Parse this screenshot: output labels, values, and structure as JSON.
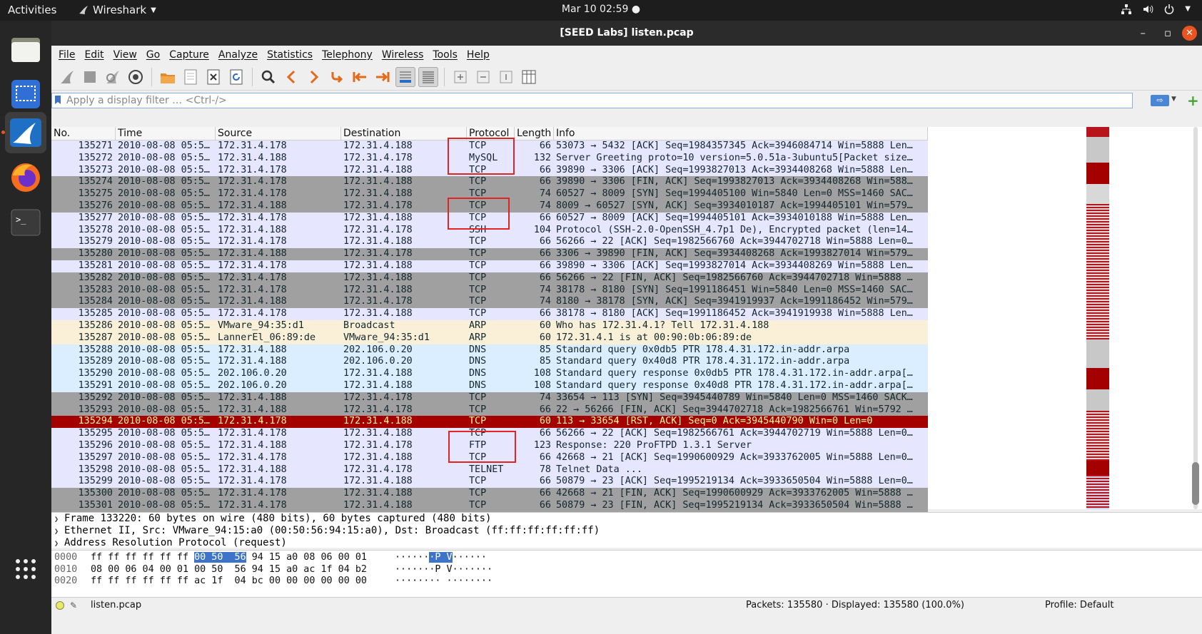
{
  "topbar": {
    "activities": "Activities",
    "app_name": "Wireshark",
    "clock": "Mar 10  02:59",
    "tray_icons": [
      "network-icon",
      "volume-icon",
      "power-icon"
    ]
  },
  "dock": {
    "items": [
      "files-icon",
      "screenshot-icon",
      "wireshark-icon",
      "firefox-icon",
      "terminal-icon"
    ],
    "grid": "show-apps-icon"
  },
  "window": {
    "title": "[SEED Labs] listen.pcap",
    "minimize": "–",
    "maximize": "▫",
    "close": "✕"
  },
  "menu": [
    "File",
    "Edit",
    "View",
    "Go",
    "Capture",
    "Analyze",
    "Statistics",
    "Telephony",
    "Wireless",
    "Tools",
    "Help"
  ],
  "filter": {
    "placeholder": "Apply a display filter … <Ctrl-/>",
    "apply": "⇨"
  },
  "columns": [
    "No.",
    "Time",
    "Source",
    "Destination",
    "Protocol",
    "Length",
    "Info"
  ],
  "packets": [
    {
      "no": "135271",
      "time": "2010-08-08 05:5…",
      "src": "172.31.4.178",
      "dst": "172.31.4.188",
      "proto": "TCP",
      "len": "66",
      "info": "53073 → 5432 [ACK] Seq=1984357345 Ack=3946084714 Win=5888 Len…",
      "style": "t-tcp"
    },
    {
      "no": "135272",
      "time": "2010-08-08 05:5…",
      "src": "172.31.4.188",
      "dst": "172.31.4.178",
      "proto": "MySQL",
      "len": "132",
      "info": "Server Greeting proto=10 version=5.0.51a-3ubuntu5[Packet size…",
      "style": "t-tcp"
    },
    {
      "no": "135273",
      "time": "2010-08-08 05:5…",
      "src": "172.31.4.178",
      "dst": "172.31.4.188",
      "proto": "TCP",
      "len": "66",
      "info": "39890 → 3306 [ACK] Seq=1993827013 Ack=3934408268 Win=5888 Len…",
      "style": "t-tcp"
    },
    {
      "no": "135274",
      "time": "2010-08-08 05:5…",
      "src": "172.31.4.178",
      "dst": "172.31.4.188",
      "proto": "TCP",
      "len": "66",
      "info": "39890 → 3306 [FIN, ACK] Seq=1993827013 Ack=3934408268 Win=588…",
      "style": "t-tcpx"
    },
    {
      "no": "135275",
      "time": "2010-08-08 05:5…",
      "src": "172.31.4.178",
      "dst": "172.31.4.188",
      "proto": "TCP",
      "len": "74",
      "info": "60527 → 8009 [SYN] Seq=1994405100 Win=5840 Len=0 MSS=1460 SAC…",
      "style": "t-tcpx"
    },
    {
      "no": "135276",
      "time": "2010-08-08 05:5…",
      "src": "172.31.4.188",
      "dst": "172.31.4.178",
      "proto": "TCP",
      "len": "74",
      "info": "8009 → 60527 [SYN, ACK] Seq=3934010187 Ack=1994405101 Win=579…",
      "style": "t-tcpx"
    },
    {
      "no": "135277",
      "time": "2010-08-08 05:5…",
      "src": "172.31.4.178",
      "dst": "172.31.4.188",
      "proto": "TCP",
      "len": "66",
      "info": "60527 → 8009 [ACK] Seq=1994405101 Ack=3934010188 Win=5888 Len…",
      "style": "t-tcp"
    },
    {
      "no": "135278",
      "time": "2010-08-08 05:5…",
      "src": "172.31.4.188",
      "dst": "172.31.4.178",
      "proto": "SSH",
      "len": "104",
      "info": "Protocol (SSH-2.0-OpenSSH_4.7p1 De), Encrypted packet (len=14…",
      "style": "t-tcp"
    },
    {
      "no": "135279",
      "time": "2010-08-08 05:5…",
      "src": "172.31.4.178",
      "dst": "172.31.4.188",
      "proto": "TCP",
      "len": "66",
      "info": "56266 → 22 [ACK] Seq=1982566760 Ack=3944702718 Win=5888 Len=0…",
      "style": "t-tcp"
    },
    {
      "no": "135280",
      "time": "2010-08-08 05:5…",
      "src": "172.31.4.188",
      "dst": "172.31.4.178",
      "proto": "TCP",
      "len": "66",
      "info": "3306 → 39890 [FIN, ACK] Seq=3934408268 Ack=1993827014 Win=579…",
      "style": "t-tcpx"
    },
    {
      "no": "135281",
      "time": "2010-08-08 05:5…",
      "src": "172.31.4.178",
      "dst": "172.31.4.188",
      "proto": "TCP",
      "len": "66",
      "info": "39890 → 3306 [ACK] Seq=1993827014 Ack=3934408269 Win=5888 Len…",
      "style": "t-tcp"
    },
    {
      "no": "135282",
      "time": "2010-08-08 05:5…",
      "src": "172.31.4.178",
      "dst": "172.31.4.188",
      "proto": "TCP",
      "len": "66",
      "info": "56266 → 22 [FIN, ACK] Seq=1982566760 Ack=3944702718 Win=5888 …",
      "style": "t-tcpx"
    },
    {
      "no": "135283",
      "time": "2010-08-08 05:5…",
      "src": "172.31.4.178",
      "dst": "172.31.4.188",
      "proto": "TCP",
      "len": "74",
      "info": "38178 → 8180 [SYN] Seq=1991186451 Win=5840 Len=0 MSS=1460 SAC…",
      "style": "t-tcpx"
    },
    {
      "no": "135284",
      "time": "2010-08-08 05:5…",
      "src": "172.31.4.188",
      "dst": "172.31.4.178",
      "proto": "TCP",
      "len": "74",
      "info": "8180 → 38178 [SYN, ACK] Seq=3941919937 Ack=1991186452 Win=579…",
      "style": "t-tcpx"
    },
    {
      "no": "135285",
      "time": "2010-08-08 05:5…",
      "src": "172.31.4.178",
      "dst": "172.31.4.188",
      "proto": "TCP",
      "len": "66",
      "info": "38178 → 8180 [ACK] Seq=1991186452 Ack=3941919938 Win=5888 Len…",
      "style": "t-tcp"
    },
    {
      "no": "135286",
      "time": "2010-08-08 05:5…",
      "src": "VMware_94:35:d1",
      "dst": "Broadcast",
      "proto": "ARP",
      "len": "60",
      "info": "Who has 172.31.4.1? Tell 172.31.4.188",
      "style": "t-arp"
    },
    {
      "no": "135287",
      "time": "2010-08-08 05:5…",
      "src": "LannerEl_06:89:de",
      "dst": "VMware_94:35:d1",
      "proto": "ARP",
      "len": "60",
      "info": "172.31.4.1 is at 00:90:0b:06:89:de",
      "style": "t-arp"
    },
    {
      "no": "135288",
      "time": "2010-08-08 05:5…",
      "src": "172.31.4.188",
      "dst": "202.106.0.20",
      "proto": "DNS",
      "len": "85",
      "info": "Standard query 0x0db5 PTR 178.4.31.172.in-addr.arpa",
      "style": "t-dns"
    },
    {
      "no": "135289",
      "time": "2010-08-08 05:5…",
      "src": "172.31.4.188",
      "dst": "202.106.0.20",
      "proto": "DNS",
      "len": "85",
      "info": "Standard query 0x40d8 PTR 178.4.31.172.in-addr.arpa",
      "style": "t-dns"
    },
    {
      "no": "135290",
      "time": "2010-08-08 05:5…",
      "src": "202.106.0.20",
      "dst": "172.31.4.188",
      "proto": "DNS",
      "len": "108",
      "info": "Standard query response 0x0db5 PTR 178.4.31.172.in-addr.arpa[…",
      "style": "t-dns"
    },
    {
      "no": "135291",
      "time": "2010-08-08 05:5…",
      "src": "202.106.0.20",
      "dst": "172.31.4.188",
      "proto": "DNS",
      "len": "108",
      "info": "Standard query response 0x40d8 PTR 178.4.31.172.in-addr.arpa[…",
      "style": "t-dns"
    },
    {
      "no": "135292",
      "time": "2010-08-08 05:5…",
      "src": "172.31.4.188",
      "dst": "172.31.4.178",
      "proto": "TCP",
      "len": "74",
      "info": "33654 → 113 [SYN] Seq=3945440789 Win=5840 Len=0 MSS=1460 SACK…",
      "style": "t-tcpx"
    },
    {
      "no": "135293",
      "time": "2010-08-08 05:5…",
      "src": "172.31.4.188",
      "dst": "172.31.4.178",
      "proto": "TCP",
      "len": "66",
      "info": "22 → 56266 [FIN, ACK] Seq=3944702718 Ack=1982566761 Win=5792 …",
      "style": "t-tcpx"
    },
    {
      "no": "135294",
      "time": "2010-08-08 05:5…",
      "src": "172.31.4.178",
      "dst": "172.31.4.188",
      "proto": "TCP",
      "len": "60",
      "info": "113 → 33654 [RST, ACK] Seq=0 Ack=3945440790 Win=0 Len=0",
      "style": "t-rst"
    },
    {
      "no": "135295",
      "time": "2010-08-08 05:5…",
      "src": "172.31.4.178",
      "dst": "172.31.4.188",
      "proto": "TCP",
      "len": "66",
      "info": "56266 → 22 [ACK] Seq=1982566761 Ack=3944702719 Win=5888 Len=0…",
      "style": "t-tcp"
    },
    {
      "no": "135296",
      "time": "2010-08-08 05:5…",
      "src": "172.31.4.188",
      "dst": "172.31.4.178",
      "proto": "FTP",
      "len": "123",
      "info": "Response: 220 ProFTPD 1.3.1 Server",
      "style": "t-ftp"
    },
    {
      "no": "135297",
      "time": "2010-08-08 05:5…",
      "src": "172.31.4.178",
      "dst": "172.31.4.188",
      "proto": "TCP",
      "len": "66",
      "info": "42668 → 21 [ACK] Seq=1990600929 Ack=3933762005 Win=5888 Len=0…",
      "style": "t-tcp"
    },
    {
      "no": "135298",
      "time": "2010-08-08 05:5…",
      "src": "172.31.4.188",
      "dst": "172.31.4.178",
      "proto": "TELNET",
      "len": "78",
      "info": "Telnet Data ...",
      "style": "t-tcp"
    },
    {
      "no": "135299",
      "time": "2010-08-08 05:5…",
      "src": "172.31.4.178",
      "dst": "172.31.4.188",
      "proto": "TCP",
      "len": "66",
      "info": "50879 → 23 [ACK] Seq=1995219134 Ack=3933650504 Win=5888 Len=0…",
      "style": "t-tcp"
    },
    {
      "no": "135300",
      "time": "2010-08-08 05:5…",
      "src": "172.31.4.178",
      "dst": "172.31.4.188",
      "proto": "TCP",
      "len": "66",
      "info": "42668 → 21 [FIN, ACK] Seq=1990600929 Ack=3933762005 Win=5888 …",
      "style": "t-tcpx"
    },
    {
      "no": "135301",
      "time": "2010-08-08 05:5…",
      "src": "172.31.4.178",
      "dst": "172.31.4.188",
      "proto": "TCP",
      "len": "66",
      "info": "50879 → 23 [FIN, ACK] Seq=1995219134 Ack=3933650504 Win=5888 …",
      "style": "t-tcpx"
    }
  ],
  "details": [
    "Frame 133220: 60 bytes on wire (480 bits), 60 bytes captured (480 bits)",
    "Ethernet II, Src: VMware_94:15:a0 (00:50:56:94:15:a0), Dst: Broadcast (ff:ff:ff:ff:ff:ff)",
    "Address Resolution Protocol (request)"
  ],
  "bytes": [
    {
      "offset": "0000",
      "hex_a": "ff ff ff ff ff ff ",
      "hex_hl": "00 50  56",
      "hex_b": " 94 15 a0 08 06 00 01",
      "asc_a": "······",
      "asc_hl": "·P V",
      "asc_b": "······"
    },
    {
      "offset": "0010",
      "hex_a": "08 00 06 04 00 01 00 50  56 94 15 a0 ac 1f 04 b2",
      "hex_hl": "",
      "hex_b": "",
      "asc_a": "·······P V·······",
      "asc_hl": "",
      "asc_b": ""
    },
    {
      "offset": "0020",
      "hex_a": "ff ff ff ff ff ff ac 1f  04 bc 00 00 00 00 00 00",
      "hex_hl": "",
      "hex_b": "",
      "asc_a": "········ ········",
      "asc_hl": "",
      "asc_b": ""
    }
  ],
  "status": {
    "file": "listen.pcap",
    "packets": "Packets: 135580 · Displayed: 135580 (100.0%)",
    "profile": "Profile: Default"
  },
  "colors": {
    "accent": "#e95420",
    "tcp_row": "#e7e6ff",
    "tcp_problem_row": "#a0a0a0",
    "arp_row": "#faf0d7",
    "dns_row": "#daeeff",
    "rst_row": "#a40000",
    "annotation_box": "#e02424"
  }
}
